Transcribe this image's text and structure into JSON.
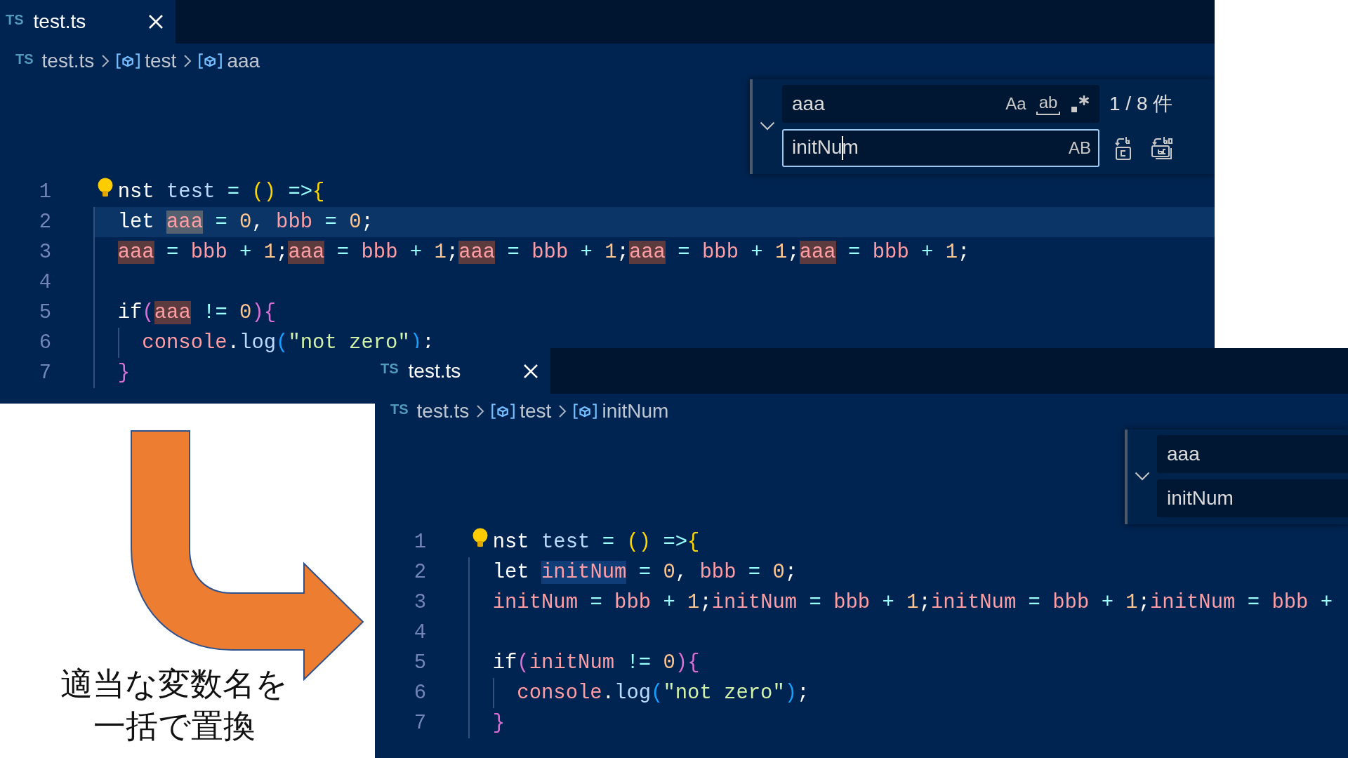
{
  "editors": [
    {
      "tabs": [
        {
          "badge": "TS",
          "label": "test.ts",
          "selected": true
        }
      ],
      "breadcrumbs": [
        {
          "kind": "file",
          "badge": "TS",
          "label": "test.ts"
        },
        {
          "kind": "variable",
          "label": "test"
        },
        {
          "kind": "variable",
          "label": "aaa"
        }
      ],
      "find_widget": {
        "replace_expanded": true,
        "find_field": {
          "value": "aaa",
          "focused": false,
          "options": [
            {
              "kind": "case",
              "label": "Aa",
              "on": false
            },
            {
              "kind": "word",
              "label": "ab",
              "on": false
            },
            {
              "kind": "regex",
              "on": false
            }
          ]
        },
        "match_count": "1 / 8 件",
        "replace_field": {
          "value": "initNum",
          "focused": true,
          "options": [
            {
              "kind": "preserve_case",
              "label": "AB",
              "on": false
            }
          ]
        },
        "replace_actions": [
          {
            "kind": "replace"
          },
          {
            "kind": "replace_all"
          }
        ]
      },
      "lines": [
        {
          "number": "1",
          "lightbulb": true,
          "tokens": [
            {
              "text": "nst ",
              "kind": "keyword"
            },
            {
              "text": "test",
              "kind": "function"
            },
            {
              "text": " = ",
              "kind": "operator"
            },
            {
              "text": "()",
              "kind": "bracket1"
            },
            {
              "text": " =>",
              "kind": "operator"
            },
            {
              "text": "{",
              "kind": "bracket1"
            }
          ],
          "children": [
            {
              "number": "2",
              "current": true,
              "tokens": [
                {
                  "text": "let ",
                  "kind": "keyword"
                },
                {
                  "text": "aaa",
                  "kind": "variable",
                  "active_match": true
                },
                {
                  "text": " = ",
                  "kind": "operator"
                },
                {
                  "text": "0",
                  "kind": "number"
                },
                {
                  "text": ", ",
                  "kind": "punctuation"
                },
                {
                  "text": "bbb",
                  "kind": "variable"
                },
                {
                  "text": " = ",
                  "kind": "operator"
                },
                {
                  "text": "0",
                  "kind": "number"
                },
                {
                  "text": ";",
                  "kind": "punctuation"
                }
              ]
            },
            {
              "number": "3",
              "tokens": [
                {
                  "text": "aaa",
                  "kind": "variable",
                  "match": true
                },
                {
                  "text": " = ",
                  "kind": "operator"
                },
                {
                  "text": "bbb",
                  "kind": "variable"
                },
                {
                  "text": " + ",
                  "kind": "operator"
                },
                {
                  "text": "1",
                  "kind": "number"
                },
                {
                  "text": ";",
                  "kind": "punctuation"
                },
                {
                  "text": "aaa",
                  "kind": "variable",
                  "match": true
                },
                {
                  "text": " = ",
                  "kind": "operator"
                },
                {
                  "text": "bbb",
                  "kind": "variable"
                },
                {
                  "text": " + ",
                  "kind": "operator"
                },
                {
                  "text": "1",
                  "kind": "number"
                },
                {
                  "text": ";",
                  "kind": "punctuation"
                },
                {
                  "text": "aaa",
                  "kind": "variable",
                  "match": true
                },
                {
                  "text": " = ",
                  "kind": "operator"
                },
                {
                  "text": "bbb",
                  "kind": "variable"
                },
                {
                  "text": " + ",
                  "kind": "operator"
                },
                {
                  "text": "1",
                  "kind": "number"
                },
                {
                  "text": ";",
                  "kind": "punctuation"
                },
                {
                  "text": "aaa",
                  "kind": "variable",
                  "match": true
                },
                {
                  "text": " = ",
                  "kind": "operator"
                },
                {
                  "text": "bbb",
                  "kind": "variable"
                },
                {
                  "text": " + ",
                  "kind": "operator"
                },
                {
                  "text": "1",
                  "kind": "number"
                },
                {
                  "text": ";",
                  "kind": "punctuation"
                },
                {
                  "text": "aaa",
                  "kind": "variable",
                  "match": true
                },
                {
                  "text": " = ",
                  "kind": "operator"
                },
                {
                  "text": "bbb",
                  "kind": "variable"
                },
                {
                  "text": " + ",
                  "kind": "operator"
                },
                {
                  "text": "1",
                  "kind": "number"
                },
                {
                  "text": ";",
                  "kind": "punctuation"
                }
              ]
            },
            {
              "number": "4"
            },
            {
              "number": "5",
              "tokens": [
                {
                  "text": "if",
                  "kind": "keyword"
                },
                {
                  "text": "(",
                  "kind": "bracket2"
                },
                {
                  "text": "aaa",
                  "kind": "variable",
                  "match": true
                },
                {
                  "text": " != ",
                  "kind": "operator"
                },
                {
                  "text": "0",
                  "kind": "number"
                },
                {
                  "text": ")",
                  "kind": "bracket2"
                },
                {
                  "text": "{",
                  "kind": "bracket2"
                }
              ],
              "children": [
                {
                  "number": "6",
                  "tokens": [
                    {
                      "text": "console",
                      "kind": "variable"
                    },
                    {
                      "text": ".",
                      "kind": "punctuation"
                    },
                    {
                      "text": "log",
                      "kind": "function"
                    },
                    {
                      "text": "(",
                      "kind": "bracket3"
                    },
                    {
                      "text": "\"not zero\"",
                      "kind": "string"
                    },
                    {
                      "text": ")",
                      "kind": "bracket3"
                    },
                    {
                      "text": ";",
                      "kind": "punctuation"
                    }
                  ]
                }
              ]
            },
            {
              "number": "7",
              "tokens": [
                {
                  "text": "}",
                  "kind": "bracket2"
                }
              ]
            }
          ]
        }
      ]
    },
    {
      "tabs": [
        {
          "badge": "TS",
          "label": "test.ts",
          "selected": true
        }
      ],
      "breadcrumbs": [
        {
          "kind": "file",
          "badge": "TS",
          "label": "test.ts"
        },
        {
          "kind": "variable",
          "label": "test"
        },
        {
          "kind": "variable",
          "label": "initNum"
        }
      ],
      "find_widget": {
        "replace_expanded": true,
        "find_field": {
          "value": "aaa",
          "focused": false
        },
        "replace_field": {
          "value": "initNum",
          "focused": false
        }
      },
      "lines": [
        {
          "number": "1",
          "lightbulb": true,
          "tokens": [
            {
              "text": "nst ",
              "kind": "keyword"
            },
            {
              "text": "test",
              "kind": "function"
            },
            {
              "text": " = ",
              "kind": "operator"
            },
            {
              "text": "()",
              "kind": "bracket1"
            },
            {
              "text": " =>",
              "kind": "operator"
            },
            {
              "text": "{",
              "kind": "bracket1"
            }
          ],
          "children": [
            {
              "number": "2",
              "tokens": [
                {
                  "text": "let ",
                  "kind": "keyword"
                },
                {
                  "text": "initNum",
                  "kind": "variable",
                  "word_highlight": true
                },
                {
                  "text": " = ",
                  "kind": "operator"
                },
                {
                  "text": "0",
                  "kind": "number"
                },
                {
                  "text": ", ",
                  "kind": "punctuation"
                },
                {
                  "text": "bbb",
                  "kind": "variable"
                },
                {
                  "text": " = ",
                  "kind": "operator"
                },
                {
                  "text": "0",
                  "kind": "number"
                },
                {
                  "text": ";",
                  "kind": "punctuation"
                }
              ]
            },
            {
              "number": "3",
              "tokens": [
                {
                  "text": "initNum",
                  "kind": "variable"
                },
                {
                  "text": " = ",
                  "kind": "operator"
                },
                {
                  "text": "bbb",
                  "kind": "variable"
                },
                {
                  "text": " + ",
                  "kind": "operator"
                },
                {
                  "text": "1",
                  "kind": "number"
                },
                {
                  "text": ";",
                  "kind": "punctuation"
                },
                {
                  "text": "initNum",
                  "kind": "variable"
                },
                {
                  "text": " = ",
                  "kind": "operator"
                },
                {
                  "text": "bbb",
                  "kind": "variable"
                },
                {
                  "text": " + ",
                  "kind": "operator"
                },
                {
                  "text": "1",
                  "kind": "number"
                },
                {
                  "text": ";",
                  "kind": "punctuation"
                },
                {
                  "text": "initNum",
                  "kind": "variable"
                },
                {
                  "text": " = ",
                  "kind": "operator"
                },
                {
                  "text": "bbb",
                  "kind": "variable"
                },
                {
                  "text": " + ",
                  "kind": "operator"
                },
                {
                  "text": "1",
                  "kind": "number"
                },
                {
                  "text": ";",
                  "kind": "punctuation"
                },
                {
                  "text": "initNum",
                  "kind": "variable"
                },
                {
                  "text": " = ",
                  "kind": "operator"
                },
                {
                  "text": "bbb",
                  "kind": "variable"
                },
                {
                  "text": " +",
                  "kind": "operator"
                }
              ]
            },
            {
              "number": "4"
            },
            {
              "number": "5",
              "tokens": [
                {
                  "text": "if",
                  "kind": "keyword"
                },
                {
                  "text": "(",
                  "kind": "bracket2"
                },
                {
                  "text": "initNum",
                  "kind": "variable"
                },
                {
                  "text": " != ",
                  "kind": "operator"
                },
                {
                  "text": "0",
                  "kind": "number"
                },
                {
                  "text": ")",
                  "kind": "bracket2"
                },
                {
                  "text": "{",
                  "kind": "bracket2"
                }
              ],
              "children": [
                {
                  "number": "6",
                  "tokens": [
                    {
                      "text": "console",
                      "kind": "variable"
                    },
                    {
                      "text": ".",
                      "kind": "punctuation"
                    },
                    {
                      "text": "log",
                      "kind": "function"
                    },
                    {
                      "text": "(",
                      "kind": "bracket3"
                    },
                    {
                      "text": "\"not zero\"",
                      "kind": "string"
                    },
                    {
                      "text": ")",
                      "kind": "bracket3"
                    },
                    {
                      "text": ";",
                      "kind": "punctuation"
                    }
                  ]
                }
              ]
            },
            {
              "number": "7",
              "tokens": [
                {
                  "text": "}",
                  "kind": "bracket2"
                }
              ]
            }
          ]
        }
      ]
    }
  ],
  "caption": "適当な変数名を一括で置換"
}
